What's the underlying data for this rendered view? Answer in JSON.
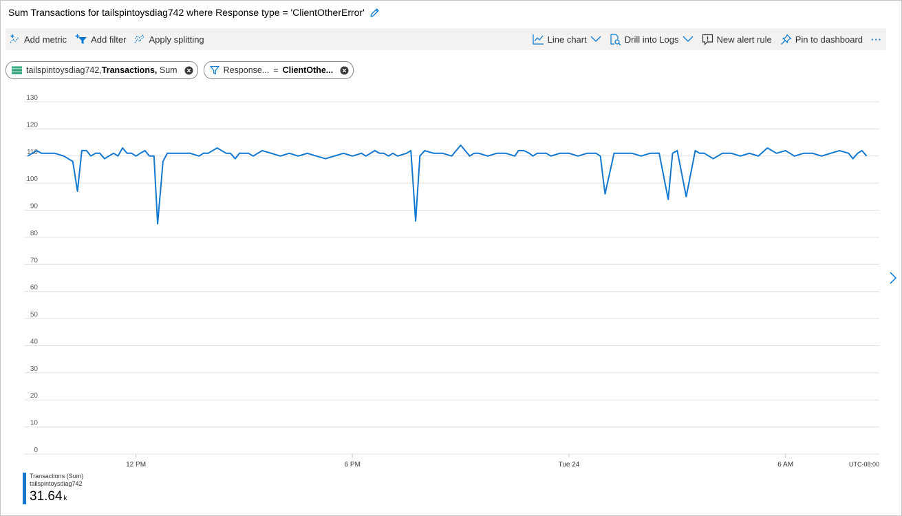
{
  "header": {
    "title": "Sum Transactions for tailspintoysdiag742 where Response type = 'ClientOtherError'",
    "edit_icon": "pencil-icon"
  },
  "toolbar": {
    "add_metric": "Add metric",
    "add_filter": "Add filter",
    "apply_splitting": "Apply splitting",
    "line_chart": "Line chart",
    "drill_logs": "Drill into Logs",
    "new_alert": "New alert rule",
    "pin_dashboard": "Pin to dashboard",
    "more": "···"
  },
  "pills": {
    "metric_resource": "tailspintoysdiag742,",
    "metric_name": "Transactions,",
    "metric_agg": "Sum",
    "filter_key": "Response...",
    "filter_op": "=",
    "filter_value": "ClientOthe..."
  },
  "colors": {
    "series": "#1177d0",
    "grid": "#e1dfdd",
    "toolbar_bg": "#f3f2f1",
    "accent": "#0078d4"
  },
  "chart_data": {
    "type": "line",
    "title": "",
    "xlabel": "",
    "ylabel": "",
    "ylim": [
      0,
      130
    ],
    "yticks": [
      0,
      10,
      20,
      30,
      40,
      50,
      60,
      70,
      80,
      90,
      100,
      110,
      120,
      130
    ],
    "x_range_hours": [
      -3.1,
      20.6
    ],
    "x_ticks": [
      {
        "label": "12 PM",
        "hour": 0
      },
      {
        "label": "6 PM",
        "hour": 6
      },
      {
        "label": "Tue 24",
        "hour": 12
      },
      {
        "label": "6 AM",
        "hour": 18
      }
    ],
    "timezone_label": "UTC-08:00",
    "grid": true,
    "series": [
      {
        "name": "Transactions (Sum)",
        "resource": "tailspintoysdiag742",
        "total": "31.64",
        "total_unit": "k",
        "x_hours": [
          -3.0,
          -2.87,
          -2.75,
          -2.62,
          -2.5,
          -2.25,
          -2.0,
          -1.75,
          -1.62,
          -1.5,
          -1.37,
          -1.25,
          -1.12,
          -1.0,
          -0.87,
          -0.75,
          -0.62,
          -0.5,
          -0.37,
          -0.25,
          -0.12,
          0.0,
          0.12,
          0.25,
          0.37,
          0.5,
          0.6,
          0.75,
          0.87,
          1.0,
          1.25,
          1.5,
          1.75,
          1.87,
          2.0,
          2.25,
          2.5,
          2.62,
          2.75,
          2.87,
          3.0,
          3.12,
          3.25,
          3.5,
          3.75,
          4.0,
          4.25,
          4.5,
          4.75,
          5.0,
          5.25,
          5.5,
          5.75,
          6.0,
          6.25,
          6.37,
          6.5,
          6.62,
          6.75,
          6.87,
          7.0,
          7.12,
          7.25,
          7.5,
          7.62,
          7.75,
          7.87,
          8.0,
          8.25,
          8.5,
          8.75,
          9.0,
          9.25,
          9.37,
          9.5,
          9.75,
          10.0,
          10.25,
          10.5,
          10.6,
          10.75,
          10.9,
          11.0,
          11.12,
          11.25,
          11.37,
          11.5,
          11.75,
          12.0,
          12.25,
          12.5,
          12.75,
          12.87,
          13.0,
          13.25,
          13.5,
          13.75,
          14.0,
          14.25,
          14.37,
          14.5,
          14.75,
          14.87,
          15.0,
          15.25,
          15.5,
          15.62,
          15.75,
          16.0,
          16.25,
          16.5,
          16.75,
          17.0,
          17.25,
          17.5,
          17.75,
          18.0,
          18.25,
          18.5,
          18.75,
          19.0,
          19.25,
          19.5,
          19.75,
          19.87,
          20.0,
          20.12,
          20.25
        ],
        "y": [
          110,
          111,
          112,
          111,
          111,
          111,
          110,
          108,
          97,
          112,
          112,
          110,
          111,
          111,
          109,
          110,
          111,
          110,
          113,
          111,
          111,
          110,
          111,
          112,
          110,
          110,
          85,
          108,
          111,
          111,
          111,
          111,
          110,
          111,
          111,
          113,
          111,
          111,
          109,
          111,
          111,
          111,
          110,
          112,
          111,
          110,
          111,
          110,
          111,
          110,
          109,
          110,
          111,
          110,
          111,
          110,
          111,
          112,
          111,
          111,
          110,
          111,
          110,
          111,
          112,
          86,
          110,
          112,
          111,
          111,
          110,
          114,
          110,
          111,
          111,
          110,
          111,
          111,
          110,
          112,
          112,
          111,
          110,
          111,
          111,
          111,
          110,
          111,
          111,
          110,
          111,
          111,
          110,
          96,
          111,
          111,
          111,
          110,
          111,
          111,
          111,
          94,
          111,
          112,
          95,
          112,
          111,
          111,
          109,
          111,
          111,
          110,
          111,
          110,
          113,
          111,
          112,
          110,
          111,
          111,
          110,
          111,
          112,
          111,
          109,
          111,
          112,
          110,
          111,
          112
        ]
      }
    ]
  }
}
